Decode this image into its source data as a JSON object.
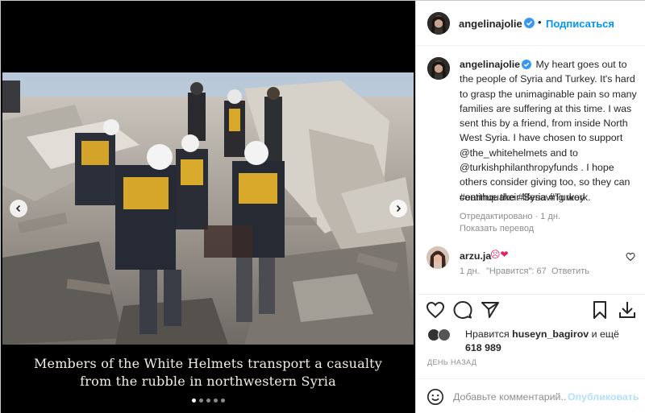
{
  "post": {
    "author": {
      "username": "angelinajolie",
      "verified": true,
      "avatar_icon": "profile-avatar"
    },
    "header": {
      "separator": "•",
      "follow_label": "Подписаться"
    },
    "media": {
      "caption_lines": [
        "Members of the White Helmets transport a casualty",
        "from the rubble in northwestern Syria"
      ],
      "carousel": {
        "count": 5,
        "active_index": 0
      },
      "prev_icon": "chevron-left-icon",
      "next_icon": "chevron-right-icon"
    },
    "caption": {
      "username": "angelinajolie",
      "text": "My heart goes out to the people of Syria and Turkey. It's hard to grasp the unimaginable pain so many families are suffering at this time. I was sent this by a friend, from inside North West Syria. I have chosen to support @the_whitehelmets and to @turkishphilanthropyfunds . I hope others consider giving too, so they can continue their lifesaving work.",
      "hashtags": "#earthquake #Syria #Turkey",
      "meta": "Отредактировано · 1 дн.",
      "translate_label": "Показать перевод"
    },
    "comment": {
      "username": "arzu.ja",
      "emojis": "☹❤",
      "time": "1 дн.",
      "likes": "\"Нравится\": 67",
      "reply_label": "Ответить",
      "like_icon": "heart-outline-icon"
    },
    "actions": {
      "like_icon": "heart-icon",
      "comment_icon": "comment-icon",
      "share_icon": "share-icon",
      "save_icon": "bookmark-icon",
      "download_icon": "download-icon"
    },
    "likes": {
      "prefix": "Нравится ",
      "user": "huseyn_bagirov",
      "middle": " и ещё ",
      "count": "618 989"
    },
    "date": "ДЕНЬ НАЗАД",
    "add_comment": {
      "placeholder": "Добавьте комментарий...",
      "publish_label": "Опубликовать",
      "emoji_icon": "smiley-icon"
    },
    "colors": {
      "link_blue": "#0095f6",
      "publish_disabled": "#b2dffc",
      "secondary_text": "#8e8e8e",
      "verified_blue": "#3897f0"
    }
  }
}
